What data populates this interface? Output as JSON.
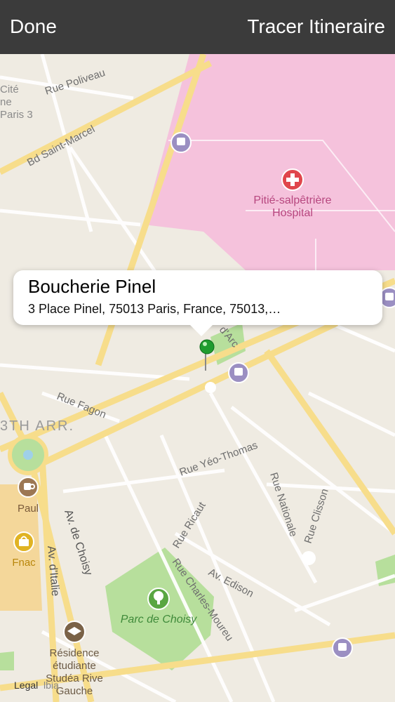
{
  "nav": {
    "done_label": "Done",
    "route_label": "Tracer Itineraire"
  },
  "callout": {
    "title": "Boucherie Pinel",
    "address": "3 Place Pinel, 75013 Paris, France, 75013,…"
  },
  "map": {
    "colors": {
      "land": "#efebe2",
      "hospital": "#f5c2dc",
      "park": "#b7df9c",
      "road_major": "#f7dd8b",
      "road_minor": "#ffffff",
      "transit": "#9b8fc2"
    },
    "labels": {
      "rue_poliveau": "Rue Poliveau",
      "bd_saint_marcel": "Bd Saint-Marcel",
      "cite_1": "Cité",
      "cite_2": "ne",
      "cite_3": "Paris 3",
      "hospital_1": "Pitié-salpêtrière",
      "hospital_2": "Hospital",
      "arc": "d'Arc",
      "rue_fagon": "Rue Fagon",
      "arrondissement": "3TH ARR.",
      "rue_yeo_thomas": "Rue Yéo-Thomas",
      "rue_nationale": "Rue Nationale",
      "rue_clisson": "Rue Clisson",
      "rue_ricaut": "Rue Ricaut",
      "av_edison": "Av. Edison",
      "rue_charles_moureu": "Rue Charles-Moureu",
      "av_de_choisy": "Av. de Choisy",
      "av_d_italie": "Av. d'Italie",
      "parc_de_choisy": "Parc de Choisy",
      "paul": "Paul",
      "fnac": "Fnac",
      "residence_1": "Résidence",
      "residence_2": "étudiante",
      "residence_3": "Studéa Rive",
      "residence_4": "Gauche",
      "legal": "Legal",
      "legal_suffix": "lbia"
    },
    "icons": [
      "transit-icon",
      "hospital-icon",
      "cafe-icon",
      "shopping-icon",
      "park-icon",
      "university-icon",
      "pin-icon"
    ]
  }
}
